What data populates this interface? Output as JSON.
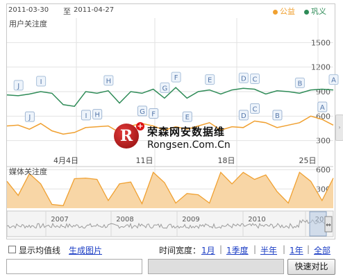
{
  "header": {
    "date_start": "2011-03-30",
    "date_sep": "至",
    "date_end": "2011-04-27",
    "legend": [
      {
        "label": "公益",
        "color": "#f0a030"
      },
      {
        "label": "巩义",
        "color": "#2e8b57"
      }
    ]
  },
  "watermark": {
    "logo_letter": "R",
    "plus": "+",
    "cn": "荣森网安数据维",
    "en": "Rongsen.Com.Cn"
  },
  "colors": {
    "orange": "#f0a030",
    "green": "#2e8b57",
    "orange_fill": "#f8d6a6",
    "grid": "#e2e2e2"
  },
  "chart_data": [
    {
      "type": "line",
      "title": "用户关注度",
      "ylim": [
        0,
        1800
      ],
      "yticks": [
        "300",
        "600",
        "900",
        "1200",
        "1500"
      ],
      "categories": [
        "4月4日",
        "11日",
        "18日",
        "25日"
      ],
      "series": [
        {
          "name": "巩义",
          "values": [
            860,
            850,
            870,
            900,
            880,
            740,
            720,
            900,
            880,
            910,
            760,
            900,
            880,
            930,
            820,
            950,
            820,
            900,
            920,
            870,
            920,
            940,
            930,
            870,
            910,
            900,
            880,
            920,
            930,
            920
          ]
        },
        {
          "name": "公益",
          "values": [
            480,
            490,
            440,
            510,
            420,
            380,
            400,
            460,
            470,
            480,
            400,
            480,
            510,
            480,
            430,
            470,
            440,
            480,
            520,
            430,
            470,
            460,
            540,
            520,
            460,
            490,
            520,
            600,
            560,
            490
          ]
        }
      ],
      "annotations": {
        "green": [
          {
            "label": "J",
            "i": 1
          },
          {
            "label": "I",
            "i": 3
          },
          {
            "label": "H",
            "i": 9
          },
          {
            "label": "G",
            "i": 14
          },
          {
            "label": "F",
            "i": 15
          },
          {
            "label": "E",
            "i": 18
          },
          {
            "label": "D",
            "i": 21
          },
          {
            "label": "C",
            "i": 22
          },
          {
            "label": "B",
            "i": 26
          },
          {
            "label": "A",
            "i": 29
          }
        ],
        "orange": [
          {
            "label": "J",
            "i": 2
          },
          {
            "label": "I",
            "i": 7
          },
          {
            "label": "H",
            "i": 8
          },
          {
            "label": "G",
            "i": 12
          },
          {
            "label": "F",
            "i": 13
          },
          {
            "label": "E",
            "i": 16
          },
          {
            "label": "D",
            "i": 21
          },
          {
            "label": "C",
            "i": 22
          },
          {
            "label": "B",
            "i": 24
          },
          {
            "label": "A",
            "i": 28
          }
        ]
      }
    },
    {
      "type": "area",
      "title": "媒体关注度",
      "ylim": [
        0,
        650
      ],
      "yticks": [
        "300",
        "600"
      ],
      "series": [
        {
          "name": "公益",
          "values": [
            420,
            200,
            540,
            380,
            60,
            40,
            460,
            470,
            450,
            120,
            380,
            410,
            70,
            560,
            400,
            80,
            230,
            210,
            80,
            560,
            380,
            560,
            450,
            520,
            260,
            80,
            560,
            420,
            120,
            470
          ]
        }
      ]
    },
    {
      "type": "area",
      "title": "",
      "categories": [
        "2007",
        "2008",
        "2009",
        "2010",
        "20"
      ]
    }
  ],
  "controls": {
    "show_avg_label": "显示均值线",
    "gen_image_label": "生成图片",
    "time_width_label": "时间宽度：",
    "ranges": [
      "1月",
      "1季度",
      "半年",
      "1年",
      "全部"
    ],
    "compare_button": "快速对比"
  }
}
